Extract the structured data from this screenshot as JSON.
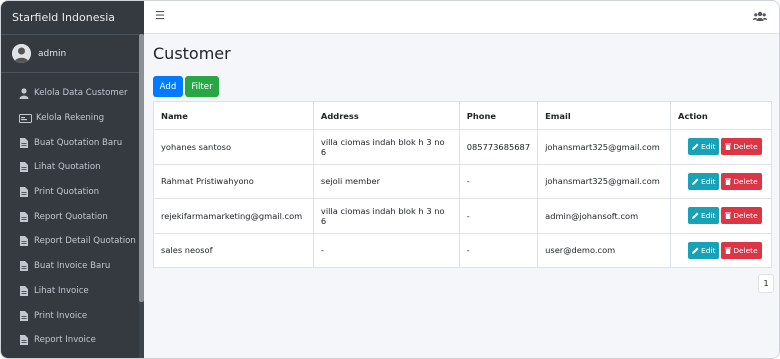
{
  "sidebar": {
    "brand": "Starfield Indonesia",
    "user": "admin",
    "items": [
      {
        "label": "Kelola Data Customer",
        "icon": "user-icon"
      },
      {
        "label": "Kelola Rekening",
        "icon": "card-icon"
      },
      {
        "label": "Buat Quotation Baru",
        "icon": "file-icon"
      },
      {
        "label": "Lihat Quotation",
        "icon": "file-icon"
      },
      {
        "label": "Print Quotation",
        "icon": "file-icon"
      },
      {
        "label": "Report Quotation",
        "icon": "file-icon"
      },
      {
        "label": "Report Detail Quotation",
        "icon": "file-icon"
      },
      {
        "label": "Buat Invoice Baru",
        "icon": "file-icon"
      },
      {
        "label": "Lihat Invoice",
        "icon": "file-icon"
      },
      {
        "label": "Print Invoice",
        "icon": "file-icon"
      },
      {
        "label": "Report Invoice",
        "icon": "file-icon"
      }
    ]
  },
  "page": {
    "title": "Customer",
    "add_label": "Add",
    "filter_label": "Filter"
  },
  "table": {
    "headers": [
      "Name",
      "Address",
      "Phone",
      "Email",
      "Action"
    ],
    "rows": [
      {
        "name": "yohanes santoso",
        "address": "villa ciomas indah blok h 3 no 6",
        "phone": "085773685687",
        "email": "johansmart325@gmail.com"
      },
      {
        "name": "Rahmat Pristiwahyono",
        "address": "sejoli member",
        "phone": "-",
        "email": "johansmart325@gmail.com"
      },
      {
        "name": "rejekifarmamarketing@gmail.com",
        "address": "villa ciomas indah blok h 3 no 6",
        "phone": "-",
        "email": "admin@johansoft.com"
      },
      {
        "name": "sales neosof",
        "address": "-",
        "phone": "-",
        "email": "user@demo.com"
      }
    ],
    "edit_label": "Edit",
    "delete_label": "Delete"
  },
  "pagination": {
    "current_page": "1"
  },
  "colors": {
    "sidebar_bg": "#343a40",
    "primary": "#007bff",
    "success": "#28a745",
    "info": "#17a2b8",
    "danger": "#dc3545"
  }
}
